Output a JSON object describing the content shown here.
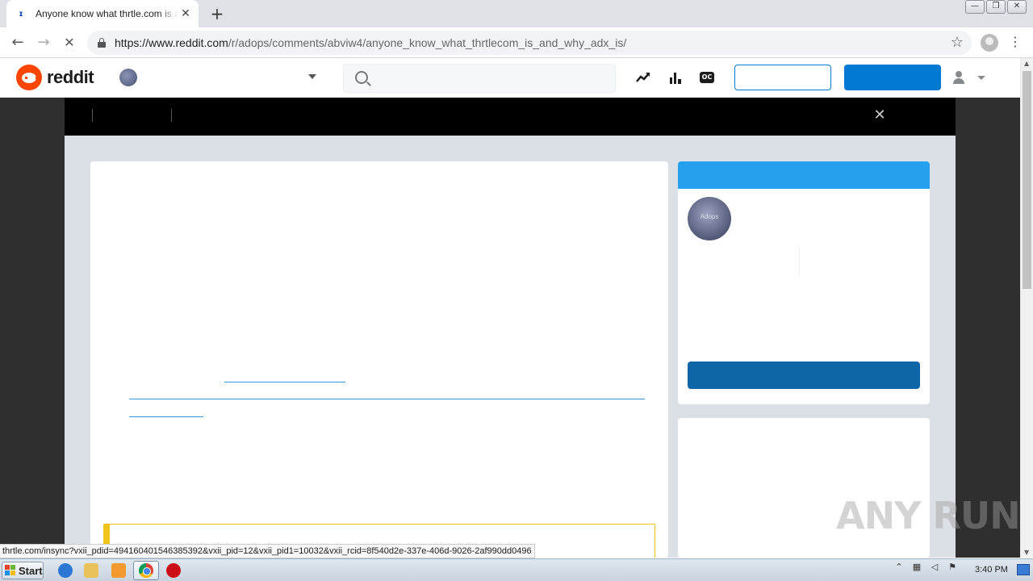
{
  "browser": {
    "tab": {
      "title": "Anyone know what thrtle.com is and why adx is",
      "favicon": "reddit-favicon",
      "close_glyph": "✕"
    },
    "new_tab_glyph": "+",
    "url_host": "https://www.reddit.com",
    "url_path": "/r/adops/comments/abviw4/anyone_know_what_thrtlecom_is_and_why_adx_is/",
    "back_glyph": "←",
    "forward_glyph": "→",
    "reload_glyph": "✕",
    "star_glyph": "☆",
    "menu_glyph": "⋮",
    "window_controls": [
      "—",
      "❐",
      "✕"
    ]
  },
  "reddit_header": {
    "wordmark": "reddit",
    "oc_label": "OC"
  },
  "modal": {
    "close_glyph": "✕"
  },
  "sidebar": {
    "avatar_text": "Adops"
  },
  "status_bar": {
    "text": "thrtle.com/insync?vxii_pdid=494160401546385392&vxii_pid=12&vxii_pid1=10032&vxii_rcid=8f540d2e-337e-406d-9026-2af990dd0496"
  },
  "watermark": "ANY RUN",
  "taskbar": {
    "start_label": "Start",
    "clock": "3:40 PM",
    "tray_icons": [
      "show-hidden-icons",
      "network-icon",
      "volume-icon",
      "action-center-flag-icon"
    ]
  },
  "colors": {
    "reddit_blue": "#0079d3",
    "sidebar_header": "#24a0ed",
    "join_button": "#0f66a6",
    "reddit_orange": "#ff4500",
    "ad_border": "#f0c419"
  }
}
